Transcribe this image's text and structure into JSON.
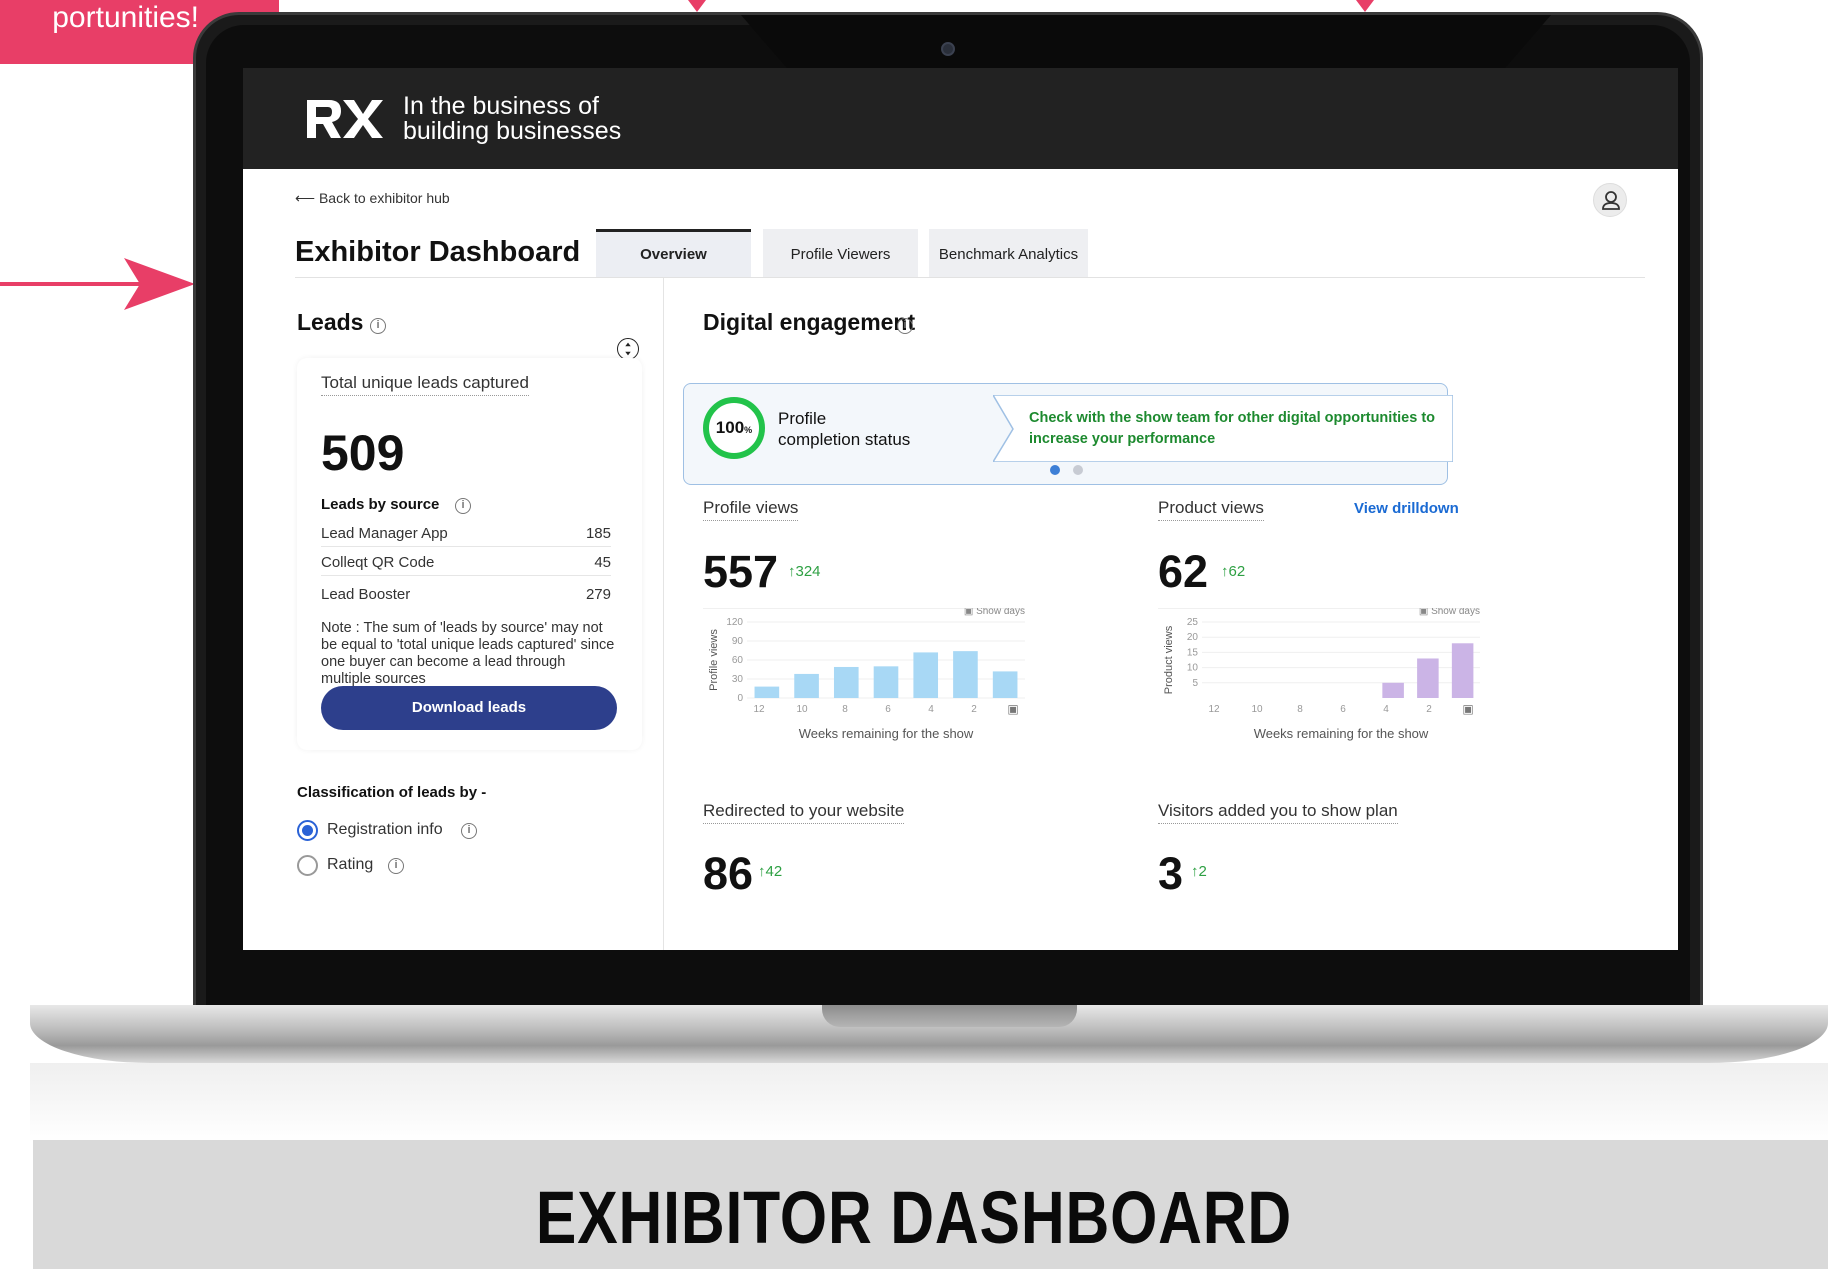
{
  "promo": {
    "text": "portunities!"
  },
  "header": {
    "tagline_line1": "In the business of",
    "tagline_line2": "building businesses"
  },
  "nav": {
    "back_label": "Back to exhibitor hub"
  },
  "page": {
    "title": "Exhibitor Dashboard",
    "tabs": [
      {
        "label": "Overview",
        "active": true
      },
      {
        "label": "Profile Viewers"
      },
      {
        "label": "Benchmark Analytics"
      }
    ]
  },
  "leads": {
    "heading": "Leads",
    "total_label": "Total unique leads captured",
    "total_value": "509",
    "by_source_label": "Leads by source",
    "sources": [
      {
        "name": "Lead Manager App",
        "value": "185"
      },
      {
        "name": "Colleqt QR Code",
        "value": "45"
      },
      {
        "name": "Lead Booster",
        "value": "279"
      }
    ],
    "note": "Note : The sum of 'leads by source' may not be equal to 'total unique leads captured' since one buyer can become a lead through multiple sources",
    "download_label": "Download leads",
    "classification_heading": "Classification of leads by -",
    "classification_options": [
      {
        "label": "Registration info",
        "selected": true
      },
      {
        "label": "Rating",
        "selected": false
      }
    ]
  },
  "engagement": {
    "heading": "Digital engagement",
    "profile_completion_value": "100",
    "profile_completion_unit": "%",
    "profile_completion_label_line1": "Profile",
    "profile_completion_label_line2": "completion status",
    "callout_text": "Check with the show team for other digital opportunities to increase your performance",
    "profile_views": {
      "label": "Profile views",
      "value": "557",
      "delta": "324"
    },
    "product_views": {
      "label": "Product views",
      "link": "View drilldown",
      "value": "62",
      "delta": "62"
    },
    "redirected": {
      "label": "Redirected to your website",
      "value": "86",
      "delta": "42"
    },
    "show_plan": {
      "label": "Visitors added you to show plan",
      "value": "3",
      "delta": "2"
    },
    "show_days_label": "Show days"
  },
  "chart_data": [
    {
      "type": "bar",
      "ylabel": "Profile views",
      "xlabel": "Weeks remaining for the show",
      "x_tick_labels": [
        "12",
        "10",
        "8",
        "6",
        "4",
        "2"
      ],
      "y_ticks": [
        "0",
        "30",
        "60",
        "90",
        "120"
      ],
      "ylim": [
        0,
        120
      ],
      "values": [
        18,
        38,
        49,
        50,
        72,
        74,
        42
      ],
      "bar_color": "#a8d8f5"
    },
    {
      "type": "bar",
      "ylabel": "Product views",
      "xlabel": "Weeks remaining for the show",
      "x_tick_labels": [
        "12",
        "10",
        "8",
        "6",
        "4",
        "2"
      ],
      "y_ticks": [
        "5",
        "10",
        "15",
        "20",
        "25"
      ],
      "ylim": [
        0,
        25
      ],
      "values": [
        0,
        0,
        0,
        0,
        0,
        5,
        13,
        18
      ],
      "bar_color": "#cbb4e6"
    }
  ],
  "caption": "EXHIBITOR DASHBOARD",
  "colors": {
    "brand_pink": "#e83e67",
    "primary_button": "#2d3f8c",
    "success_green": "#2ea043",
    "link_blue": "#1a6ad3"
  }
}
